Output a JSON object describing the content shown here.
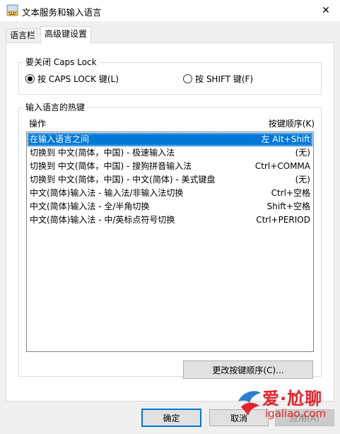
{
  "window": {
    "title": "文本服务和输入语言",
    "close_glyph": "✕"
  },
  "tabs": [
    {
      "label": "语言栏"
    },
    {
      "label": "高级键设置"
    }
  ],
  "caps_lock_group": {
    "label": "要关闭 Caps Lock",
    "options": [
      {
        "label": "按 CAPS LOCK 键(L)",
        "checked": true
      },
      {
        "label": "按 SHIFT 键(F)",
        "checked": false
      }
    ]
  },
  "hotkeys_group": {
    "label": "输入语言的热键",
    "col_action": "操作",
    "col_keys": "按键顺序(K)",
    "rows": [
      {
        "action": "在输入语言之间",
        "keys": "左 Alt+Shift",
        "selected": true
      },
      {
        "action": "切换到 中文(简体，中国) - 极速输入法",
        "keys": "(无)"
      },
      {
        "action": "切换到 中文(简体，中国) - 搜狗拼音输入法",
        "keys": "Ctrl+COMMA"
      },
      {
        "action": "切换到 中文(简体，中国) - 中文(简体) - 美式键盘",
        "keys": "(无)"
      },
      {
        "action": "中文(简体)输入法 - 输入法/非输入法切换",
        "keys": "Ctrl+空格"
      },
      {
        "action": "中文(简体)输入法 - 全/半角切换",
        "keys": "Shift+空格"
      },
      {
        "action": "中文(简体)输入法 - 中/英标点符号切换",
        "keys": "Ctrl+PERIOD"
      }
    ],
    "change_button": "更改按键顺序(C)..."
  },
  "buttons": {
    "ok": "确定",
    "cancel": "取消",
    "apply": "应用(A)"
  },
  "watermark": {
    "line1": "爱·尬聊",
    "line2": "igaliao.com",
    "color": "#e8202a"
  }
}
